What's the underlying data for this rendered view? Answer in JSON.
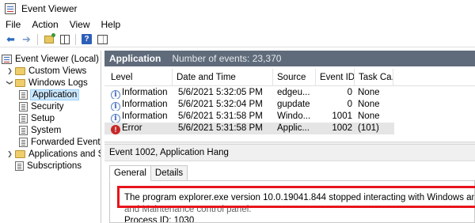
{
  "window": {
    "title": "Event Viewer"
  },
  "menu": [
    "File",
    "Action",
    "View",
    "Help"
  ],
  "toolbar": {
    "icons": [
      "back-arrow-icon",
      "forward-arrow-icon",
      "open-folder-icon",
      "show-hide-console-tree-icon",
      "help-icon",
      "show-hide-action-pane-icon"
    ]
  },
  "tree": {
    "items": [
      {
        "label": "Event Viewer (Local)",
        "icon": "event-viewer-icon"
      },
      {
        "label": "Custom Views",
        "icon": "folder-icon"
      },
      {
        "label": "Windows Logs",
        "icon": "folder-icon"
      },
      {
        "label": "Application",
        "icon": "log-icon"
      },
      {
        "label": "Security",
        "icon": "log-icon"
      },
      {
        "label": "Setup",
        "icon": "log-icon"
      },
      {
        "label": "System",
        "icon": "log-icon"
      },
      {
        "label": "Forwarded Events",
        "icon": "log-icon"
      },
      {
        "label": "Applications and Services Logs",
        "icon": "folder-icon"
      },
      {
        "label": "Subscriptions",
        "icon": "log-icon"
      }
    ]
  },
  "list": {
    "title": "Application",
    "count": "Number of events: 23,370",
    "columns": [
      "Level",
      "Date and Time",
      "Source",
      "Event ID",
      "Task Ca..."
    ],
    "rows": [
      {
        "level": "Information",
        "datetime": "5/6/2021 5:32:05 PM",
        "source": "edgeu...",
        "event_id": "0",
        "task": "None"
      },
      {
        "level": "Information",
        "datetime": "5/6/2021 5:32:04 PM",
        "source": "gupdate",
        "event_id": "0",
        "task": "None"
      },
      {
        "level": "Information",
        "datetime": "5/6/2021 5:31:58 PM",
        "source": "Windo...",
        "event_id": "1001",
        "task": "None"
      },
      {
        "level": "Error",
        "datetime": "5/6/2021 5:31:58 PM",
        "source": "Applic...",
        "event_id": "1002",
        "task": "(101)"
      }
    ]
  },
  "details": {
    "header": "Event 1002, Application Hang",
    "tabs": [
      "General",
      "Details"
    ],
    "lines": [
      "The program explorer.exe version 10.0.19041.844 stopped interacting with Windows and was closed.",
      "and Maintenance control panel.",
      "Process ID: 1030"
    ]
  },
  "colors": {
    "list_header_bg": "#5f6b7a",
    "highlight_border": "#e8141c",
    "selection": "#cce8ff"
  }
}
